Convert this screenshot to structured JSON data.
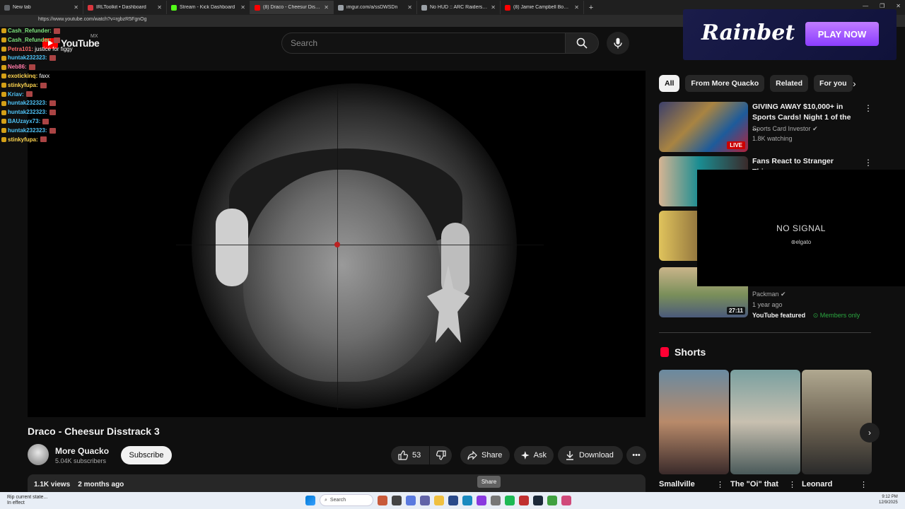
{
  "browser": {
    "tabs": [
      {
        "label": "New tab",
        "color": "#5f6368",
        "active": false
      },
      {
        "label": "IRLToolkit • Dashboard",
        "color": "#d9363e",
        "active": false
      },
      {
        "label": "Stream - Kick Dashboard",
        "color": "#53fc18",
        "active": false
      },
      {
        "label": "(8) Draco - Cheesur Disstrack",
        "color": "#ff0000",
        "active": true
      },
      {
        "label": "imgur.com/a/ssDWSDn",
        "color": "#9aa0a6",
        "active": false
      },
      {
        "label": "No HUD :: ARC Raiders General Di...",
        "color": "#9aa0a6",
        "active": false
      },
      {
        "label": "(8) Jamie Campbell Bower do the...",
        "color": "#ff0000",
        "active": false
      }
    ],
    "url": "https://www.youtube.com/watch?v=rgbzR5FgnOg"
  },
  "youtube": {
    "logo_text": "YouTube",
    "country": "MX",
    "search_placeholder": "Search"
  },
  "ad": {
    "brand": "Rainbet",
    "cta": "PLAY NOW"
  },
  "chat": [
    {
      "user": "Cash_Refunder:",
      "color": "#7ce37c",
      "msg": ""
    },
    {
      "user": "Cash_Refunder:",
      "color": "#7ce37c",
      "msg": ""
    },
    {
      "user": "Petra101:",
      "color": "#ff6b6b",
      "msg": "justice for figgy"
    },
    {
      "user": "huntak232323:",
      "color": "#4fc3f7",
      "msg": ""
    },
    {
      "user": "Neb86:",
      "color": "#ff7aa8",
      "msg": ""
    },
    {
      "user": "exotickinq:",
      "color": "#ffd54f",
      "msg": "faxx"
    },
    {
      "user": "stinkyfupa:",
      "color": "#ffd54f",
      "msg": ""
    },
    {
      "user": "Kriav:",
      "color": "#4fc3f7",
      "msg": ""
    },
    {
      "user": "huntak232323:",
      "color": "#4fc3f7",
      "msg": ""
    },
    {
      "user": "huntak232323:",
      "color": "#4fc3f7",
      "msg": ""
    },
    {
      "user": "BAUzayx73:",
      "color": "#4fc3f7",
      "msg": ""
    },
    {
      "user": "huntak232323:",
      "color": "#4fc3f7",
      "msg": ""
    },
    {
      "user": "stinkyfupa:",
      "color": "#ffd54f",
      "msg": ""
    }
  ],
  "video": {
    "title": "Draco - Cheesur Disstrack 3",
    "channel": "More Quacko",
    "subscribers": "5.04K subscribers",
    "subscribe_label": "Subscribe",
    "likes": "53",
    "share_label": "Share",
    "ask_label": "Ask",
    "download_label": "Download",
    "tooltip": "Share",
    "views": "1.1K views",
    "age": "2 months ago"
  },
  "sidebar": {
    "chips": [
      "All",
      "From More Quacko",
      "Related",
      "For you"
    ],
    "recommendations": [
      {
        "title": "GIVING AWAY $10,000+ in Sports Cards! Night 1 of the ...",
        "channel": "Sports Card Investor",
        "meta": "1.8K watching",
        "badge": "LIVE"
      },
      {
        "title": "Fans React to Stranger Things",
        "channel": "",
        "meta": "",
        "badge": ""
      },
      {
        "title": "",
        "channel": "",
        "meta": "",
        "badge": ""
      },
      {
        "title": "",
        "channel": "Packman",
        "meta": "1 year ago",
        "badge": "27:11",
        "featured": "YouTube featured",
        "members": "Members only"
      }
    ],
    "no_signal": "NO SIGNAL",
    "elgato": "elgato",
    "shorts_heading": "Shorts",
    "shorts": [
      "Smallville",
      "The \"Oi\" that",
      "Leonard"
    ]
  },
  "taskbar": {
    "notif_line1": "Rip current state...",
    "notif_line2": "In effect",
    "search": "Search",
    "time": "9:12 PM",
    "date": "12/9/2025"
  }
}
